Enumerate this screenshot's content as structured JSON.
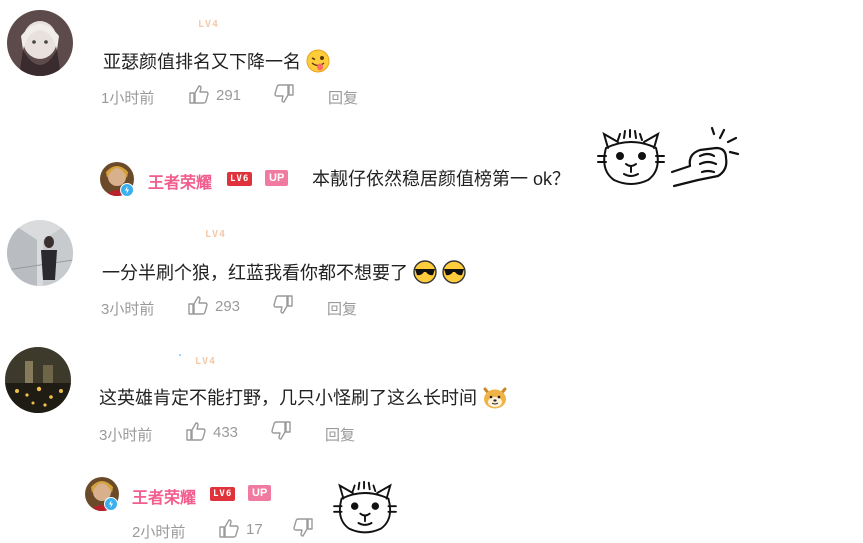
{
  "comments": [
    {
      "level": "LV4",
      "text": "亚瑟颜值排名又下降一名",
      "time": "1小时前",
      "likes": "291",
      "reply_label": "回复",
      "emoji": "tongue-wink-emoji"
    },
    {
      "level": "LV4",
      "text": "一分半刷个狼，红蓝我看你都不想要了",
      "time": "3小时前",
      "likes": "293",
      "reply_label": "回复",
      "emoji": "doge-sunglasses-emoji"
    },
    {
      "level": "LV4",
      "text": "这英雄肯定不能打野，几只小怪刷了这么长时间",
      "time": "3小时前",
      "likes": "433",
      "reply_label": "回复",
      "emoji": "shiba-dog-emoji"
    }
  ],
  "replies": [
    {
      "username": "王者荣耀",
      "level": "LV6",
      "badge": "UP",
      "text": "本靓仔依然稳居颜值榜第一 ok？",
      "stickers": [
        "cat-face-sticker",
        "fist-bump-sticker"
      ]
    },
    {
      "username": "王者荣耀",
      "level": "LV6",
      "badge": "UP",
      "time": "2小时前",
      "likes": "17",
      "stickers": [
        "cat-face-sticker"
      ]
    }
  ],
  "colors": {
    "username_up": "#f25d8e",
    "level_pale": "#f6c9a9",
    "level_red": "#e0323a",
    "up_badge": "#f07aa0",
    "meta_gray": "#9a9a9a",
    "verified_blue": "#3ab0ee"
  }
}
